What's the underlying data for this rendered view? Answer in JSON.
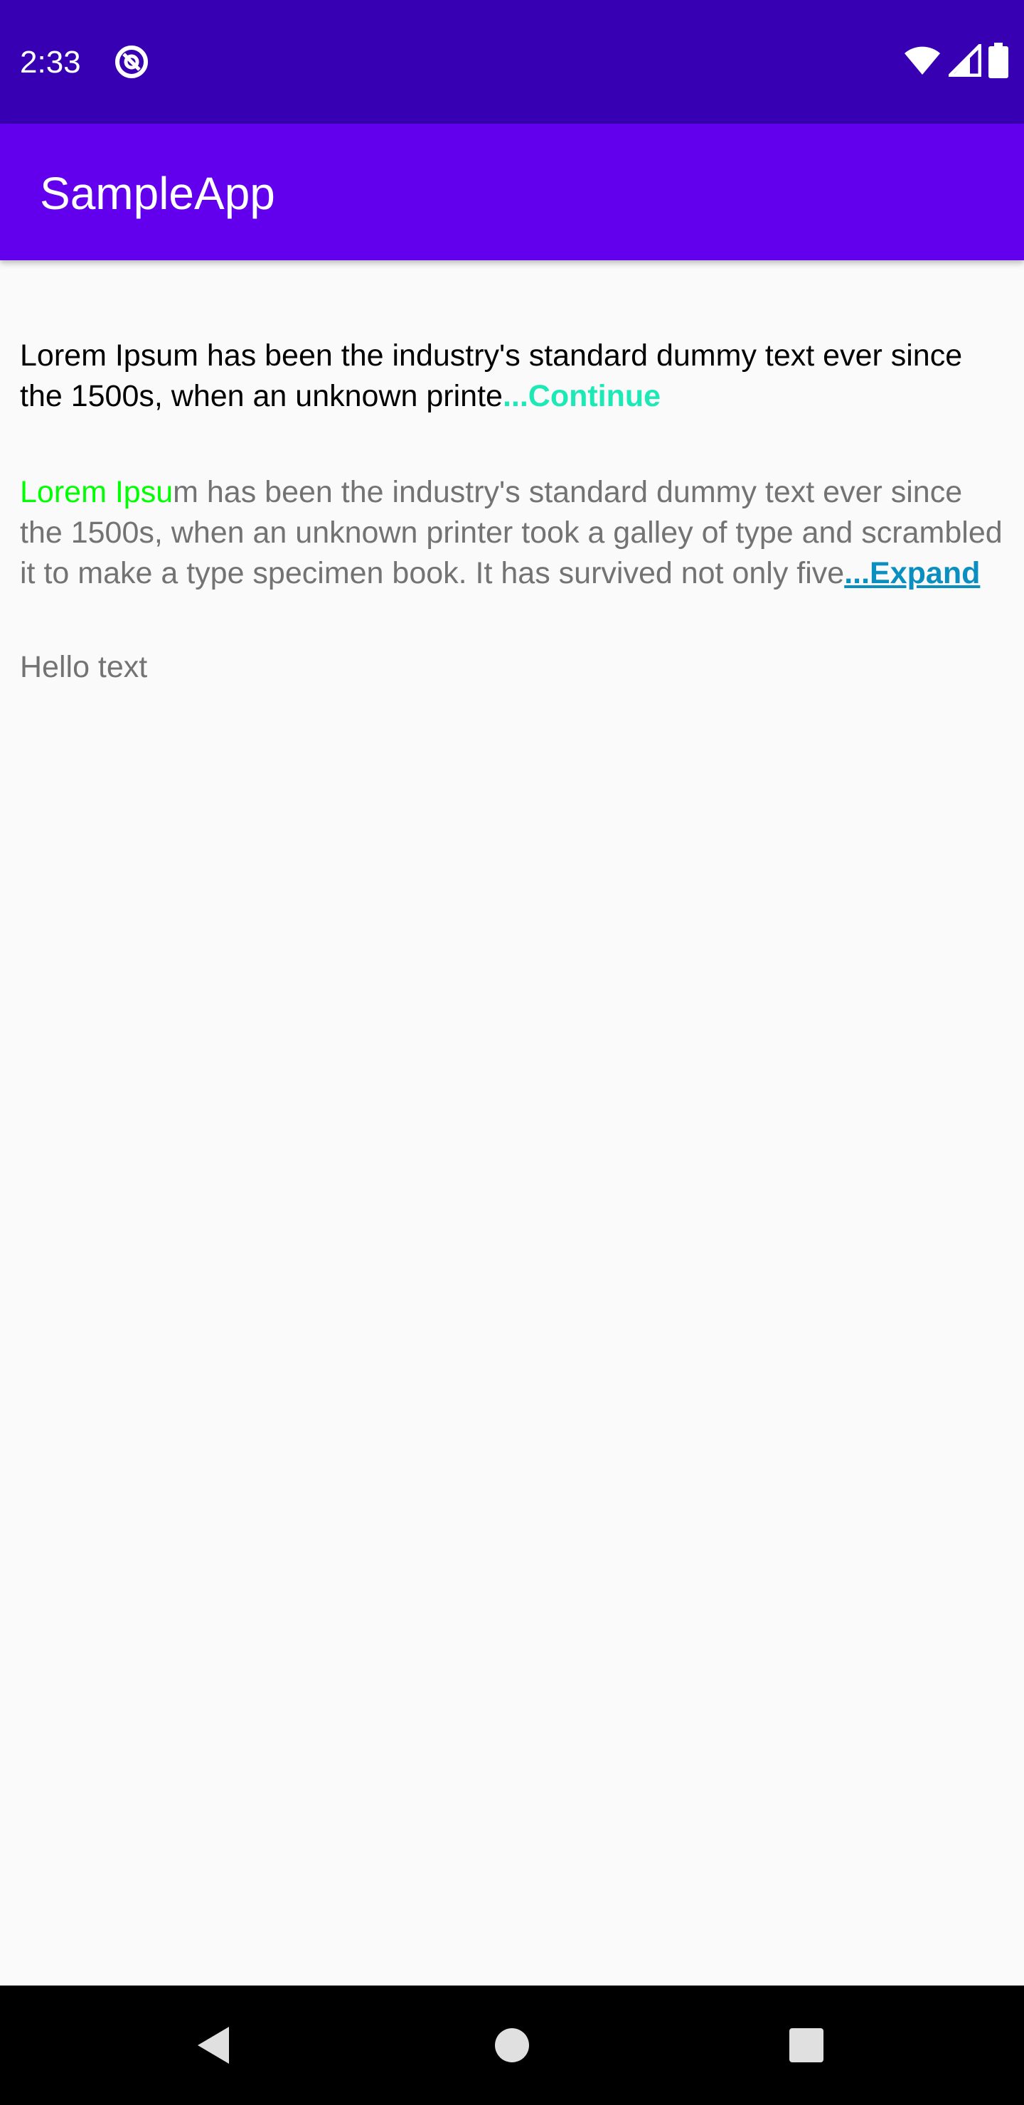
{
  "status_bar": {
    "time": "2:33",
    "app_icon": "at-sign-icon",
    "icons": [
      "wifi-icon",
      "cellular-signal-icon",
      "battery-icon"
    ],
    "background": "#3700b3"
  },
  "app_bar": {
    "title": "SampleApp",
    "background": "#6200ee"
  },
  "content": {
    "paragraph1": {
      "text": "Lorem Ipsum has been the industry's standard dummy text ever since the 1500s, when an unknown printe",
      "link_label": "...Continue",
      "link_color": "#1de9b6"
    },
    "paragraph2": {
      "highlight_text": "Lorem Ipsu",
      "text": "m has been the industry's standard dummy text ever since the 1500s, when an unknown printer took a galley of type and scrambled it to make a type specimen book. It has survived not only five",
      "link_label": "...Expand",
      "highlight_color": "#00ff00",
      "link_color": "#0a8fc0"
    },
    "hello_text": "Hello text"
  },
  "nav_bar": {
    "buttons": [
      "back-icon",
      "home-icon",
      "recents-icon"
    ]
  }
}
